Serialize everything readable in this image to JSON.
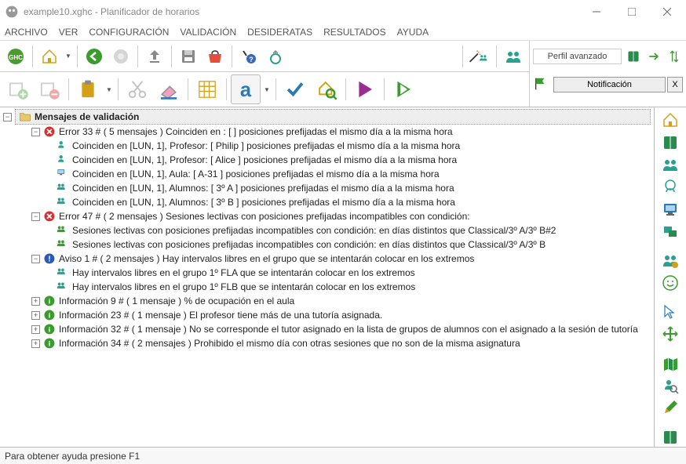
{
  "window": {
    "title": "example10.xghc - Planificador de horarios"
  },
  "menu": [
    "ARCHIVO",
    "VER",
    "CONFIGURACIÓN",
    "VALIDACIÓN",
    "DESIDERATAS",
    "RESULTADOS",
    "AYUDA"
  ],
  "profile": {
    "label": "Perfil avanzado"
  },
  "notification": {
    "label": "Notificación",
    "close": "X"
  },
  "tree": {
    "root": "Mensajes de validación",
    "nodes": [
      {
        "exp": "-",
        "indent": 1,
        "icon": "error",
        "text": "Error 33 # ( 5 mensajes )  Coinciden en : [   ] posiciones prefijadas el mismo día a la misma hora",
        "children": [
          {
            "icon": "teacher",
            "text": "Coinciden en [LUN, 1], Profesor: [ Philip ] posiciones prefijadas el mismo día a la misma hora"
          },
          {
            "icon": "teacher",
            "text": "Coinciden en [LUN, 1], Profesor: [ Alice ] posiciones prefijadas el mismo día a la misma hora"
          },
          {
            "icon": "room",
            "text": "Coinciden en [LUN, 1], Aula: [ A-31 ] posiciones prefijadas el mismo día a la misma hora"
          },
          {
            "icon": "group",
            "text": "Coinciden en [LUN, 1], Alumnos: [ 3º A ] posiciones prefijadas el mismo día a la misma hora"
          },
          {
            "icon": "group",
            "text": "Coinciden en [LUN, 1], Alumnos: [ 3º B ] posiciones prefijadas el mismo día a la misma hora"
          }
        ]
      },
      {
        "exp": "-",
        "indent": 1,
        "icon": "error",
        "text": "Error 47 # ( 2 mensajes )  Sesiones lectivas con posiciones prefijadas incompatibles con condición:",
        "children": [
          {
            "icon": "group-green",
            "text": "Sesiones lectivas con posiciones prefijadas incompatibles con condición: en días distintos que Classical/3º A/3º B#2"
          },
          {
            "icon": "group-green",
            "text": "Sesiones lectivas con posiciones prefijadas incompatibles con condición: en días distintos que Classical/3º A/3º B"
          }
        ]
      },
      {
        "exp": "-",
        "indent": 1,
        "icon": "warn",
        "text": "Aviso 1 # ( 2 mensajes )  Hay intervalos libres en el grupo   que se intentarán colocar en los extremos",
        "children": [
          {
            "icon": "group",
            "text": "Hay intervalos libres en el grupo 1º FLA  que se intentarán colocar en los extremos"
          },
          {
            "icon": "group",
            "text": "Hay intervalos libres en el grupo 1º FLB  que se intentarán colocar en los extremos"
          }
        ]
      },
      {
        "exp": "+",
        "indent": 1,
        "icon": "info",
        "text": "Información 9 # ( 1 mensaje )  % de ocupación en el aula"
      },
      {
        "exp": "+",
        "indent": 1,
        "icon": "info",
        "text": "Información 23 # ( 1 mensaje )  El profesor  tiene más de una tutoría asignada."
      },
      {
        "exp": "+",
        "indent": 1,
        "icon": "info",
        "text": "Información 32 # ( 1 mensaje )  No se corresponde el tutor asignado en la lista de grupos de alumnos  con el asignado a la sesión de tutoría"
      },
      {
        "exp": "+",
        "indent": 1,
        "icon": "info",
        "text": "Información 34 # ( 2 mensajes ) Prohibido el mismo día con otras sesiones que no son de la misma asignatura"
      }
    ]
  },
  "statusbar": "Para obtener ayuda presione F1",
  "icons": {
    "folder": "folder-icon",
    "error": "error-icon",
    "warn": "warn-icon",
    "info": "info-icon",
    "teacher": "person-icon",
    "room": "monitor-icon",
    "group": "people-icon",
    "group-green": "people-green-icon"
  }
}
